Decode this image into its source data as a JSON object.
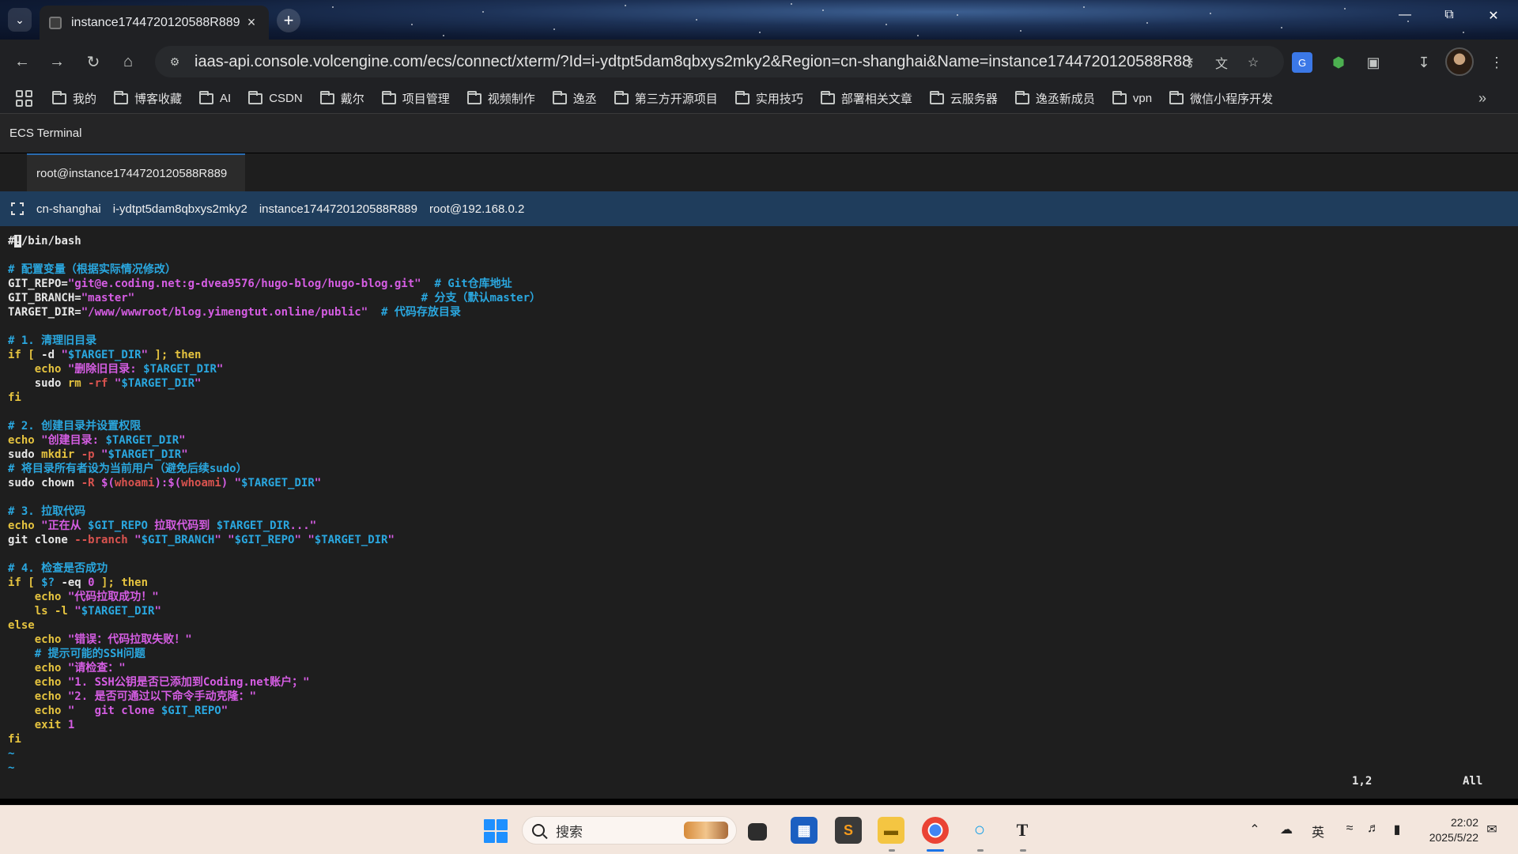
{
  "browser": {
    "tab_title": "instance1744720120588R889",
    "url": "iaas-api.console.volcengine.com/ecs/connect/xterm/?Id=i-ydtpt5dam8qbxys2mky2&Region=cn-shanghai&Name=instance1744720120588R889...",
    "bookmarks": [
      "我的",
      "博客收藏",
      "AI",
      "CSDN",
      "戴尔",
      "项目管理",
      "视频制作",
      "逸丞",
      "第三方开源项目",
      "实用技巧",
      "部署相关文章",
      "云服务器",
      "逸丞新成员",
      "vpn",
      "微信小程序开发"
    ]
  },
  "page": {
    "app_title": "ECS Terminal",
    "session_tab": "root@instance1744720120588R889",
    "info": {
      "region": "cn-shanghai",
      "instance_id": "i-ydtpt5dam8qbxys2mky2",
      "instance_name": "instance1744720120588R889",
      "login": "root@192.168.0.2"
    }
  },
  "terminal": {
    "lines": [
      [
        {
          "t": "#",
          "c": ""
        },
        {
          "t": "!",
          "c": "cursor"
        },
        {
          "t": "/bin/bash",
          "c": ""
        }
      ],
      [],
      [
        {
          "t": "# 配置变量（根据实际情况修改）",
          "c": "c-comment"
        }
      ],
      [
        {
          "t": "GIT_REPO=",
          "c": ""
        },
        {
          "t": "\"git@e.coding.net:g-dvea9576/hugo-blog/hugo-blog.git\"",
          "c": "c-str"
        },
        {
          "t": "  # Git仓库地址",
          "c": "c-comment"
        }
      ],
      [
        {
          "t": "GIT_BRANCH=",
          "c": ""
        },
        {
          "t": "\"master\"",
          "c": "c-str"
        },
        {
          "t": "                                           # 分支（默认master）",
          "c": "c-comment"
        }
      ],
      [
        {
          "t": "TARGET_DIR=",
          "c": ""
        },
        {
          "t": "\"/www/wwwroot/blog.yimengtut.online/public\"",
          "c": "c-str"
        },
        {
          "t": "  # 代码存放目录",
          "c": "c-comment"
        }
      ],
      [],
      [
        {
          "t": "# 1. 清理旧目录",
          "c": "c-comment"
        }
      ],
      [
        {
          "t": "if [ ",
          "c": "c-kw"
        },
        {
          "t": "-d ",
          "c": ""
        },
        {
          "t": "\"",
          "c": "c-str"
        },
        {
          "t": "$TARGET_DIR",
          "c": "c-var"
        },
        {
          "t": "\"",
          "c": "c-str"
        },
        {
          "t": " ]; then",
          "c": "c-kw"
        }
      ],
      [
        {
          "t": "    echo ",
          "c": "c-kw"
        },
        {
          "t": "\"删除旧目录: ",
          "c": "c-str"
        },
        {
          "t": "$TARGET_DIR",
          "c": "c-var"
        },
        {
          "t": "\"",
          "c": "c-str"
        }
      ],
      [
        {
          "t": "    sudo ",
          "c": ""
        },
        {
          "t": "rm ",
          "c": "c-kw"
        },
        {
          "t": "-rf ",
          "c": "c-opt"
        },
        {
          "t": "\"",
          "c": "c-str"
        },
        {
          "t": "$TARGET_DIR",
          "c": "c-var"
        },
        {
          "t": "\"",
          "c": "c-str"
        }
      ],
      [
        {
          "t": "fi",
          "c": "c-kw"
        }
      ],
      [],
      [
        {
          "t": "# 2. 创建目录并设置权限",
          "c": "c-comment"
        }
      ],
      [
        {
          "t": "echo ",
          "c": "c-kw"
        },
        {
          "t": "\"创建目录: ",
          "c": "c-str"
        },
        {
          "t": "$TARGET_DIR",
          "c": "c-var"
        },
        {
          "t": "\"",
          "c": "c-str"
        }
      ],
      [
        {
          "t": "sudo ",
          "c": ""
        },
        {
          "t": "mkdir ",
          "c": "c-kw"
        },
        {
          "t": "-p ",
          "c": "c-opt"
        },
        {
          "t": "\"",
          "c": "c-str"
        },
        {
          "t": "$TARGET_DIR",
          "c": "c-var"
        },
        {
          "t": "\"",
          "c": "c-str"
        }
      ],
      [
        {
          "t": "# 将目录所有者设为当前用户（避免后续sudo）",
          "c": "c-comment"
        }
      ],
      [
        {
          "t": "sudo chown ",
          "c": ""
        },
        {
          "t": "-R ",
          "c": "c-opt"
        },
        {
          "t": "$(",
          "c": "c-str"
        },
        {
          "t": "whoami",
          "c": "c-opt"
        },
        {
          "t": "):$(",
          "c": "c-str"
        },
        {
          "t": "whoami",
          "c": "c-opt"
        },
        {
          "t": ") ",
          "c": "c-str"
        },
        {
          "t": "\"",
          "c": "c-str"
        },
        {
          "t": "$TARGET_DIR",
          "c": "c-var"
        },
        {
          "t": "\"",
          "c": "c-str"
        }
      ],
      [],
      [
        {
          "t": "# 3. 拉取代码",
          "c": "c-comment"
        }
      ],
      [
        {
          "t": "echo ",
          "c": "c-kw"
        },
        {
          "t": "\"正在从 ",
          "c": "c-str"
        },
        {
          "t": "$GIT_REPO",
          "c": "c-var"
        },
        {
          "t": " 拉取代码到 ",
          "c": "c-str"
        },
        {
          "t": "$TARGET_DIR",
          "c": "c-var"
        },
        {
          "t": "...\"",
          "c": "c-str"
        }
      ],
      [
        {
          "t": "git clone ",
          "c": ""
        },
        {
          "t": "--branch ",
          "c": "c-opt"
        },
        {
          "t": "\"",
          "c": "c-str"
        },
        {
          "t": "$GIT_BRANCH",
          "c": "c-var"
        },
        {
          "t": "\" \"",
          "c": "c-str"
        },
        {
          "t": "$GIT_REPO",
          "c": "c-var"
        },
        {
          "t": "\" \"",
          "c": "c-str"
        },
        {
          "t": "$TARGET_DIR",
          "c": "c-var"
        },
        {
          "t": "\"",
          "c": "c-str"
        }
      ],
      [],
      [
        {
          "t": "# 4. 检查是否成功",
          "c": "c-comment"
        }
      ],
      [
        {
          "t": "if [ ",
          "c": "c-kw"
        },
        {
          "t": "$? ",
          "c": "c-var"
        },
        {
          "t": "-eq ",
          "c": ""
        },
        {
          "t": "0",
          "c": "c-num"
        },
        {
          "t": " ]; then",
          "c": "c-kw"
        }
      ],
      [
        {
          "t": "    echo ",
          "c": "c-kw"
        },
        {
          "t": "\"代码拉取成功！\"",
          "c": "c-str"
        }
      ],
      [
        {
          "t": "    ls -l ",
          "c": "c-kw"
        },
        {
          "t": "\"",
          "c": "c-str"
        },
        {
          "t": "$TARGET_DIR",
          "c": "c-var"
        },
        {
          "t": "\"",
          "c": "c-str"
        }
      ],
      [
        {
          "t": "else",
          "c": "c-kw"
        }
      ],
      [
        {
          "t": "    echo ",
          "c": "c-kw"
        },
        {
          "t": "\"错误：代码拉取失败！\"",
          "c": "c-str"
        }
      ],
      [
        {
          "t": "    # 提示可能的SSH问题",
          "c": "c-comment"
        }
      ],
      [
        {
          "t": "    echo ",
          "c": "c-kw"
        },
        {
          "t": "\"请检查：\"",
          "c": "c-str"
        }
      ],
      [
        {
          "t": "    echo ",
          "c": "c-kw"
        },
        {
          "t": "\"1. SSH公钥是否已添加到Coding.net账户；\"",
          "c": "c-str"
        }
      ],
      [
        {
          "t": "    echo ",
          "c": "c-kw"
        },
        {
          "t": "\"2. 是否可通过以下命令手动克隆：\"",
          "c": "c-str"
        }
      ],
      [
        {
          "t": "    echo ",
          "c": "c-kw"
        },
        {
          "t": "\"   git clone ",
          "c": "c-str"
        },
        {
          "t": "$GIT_REPO",
          "c": "c-var"
        },
        {
          "t": "\"",
          "c": "c-str"
        }
      ],
      [
        {
          "t": "    exit ",
          "c": "c-kw"
        },
        {
          "t": "1",
          "c": "c-num"
        }
      ],
      [
        {
          "t": "fi",
          "c": "c-kw"
        }
      ],
      [
        {
          "t": "~",
          "c": "c-tilde"
        }
      ],
      [
        {
          "t": "~",
          "c": "c-tilde"
        }
      ]
    ],
    "cursor_position": "1,2",
    "scroll_status": "All"
  },
  "taskbar": {
    "search_placeholder": "搜索",
    "ime": "英",
    "time": "22:02",
    "date": "2025/5/22"
  },
  "colors": {
    "terminal_bg": "#1e1e1e",
    "comment": "#2aa7df",
    "keyword": "#e5c33f",
    "string": "#d55de3",
    "option": "#d9534f",
    "info_bar": "#1f3d5c",
    "tab_accent": "#2b6cb0"
  }
}
